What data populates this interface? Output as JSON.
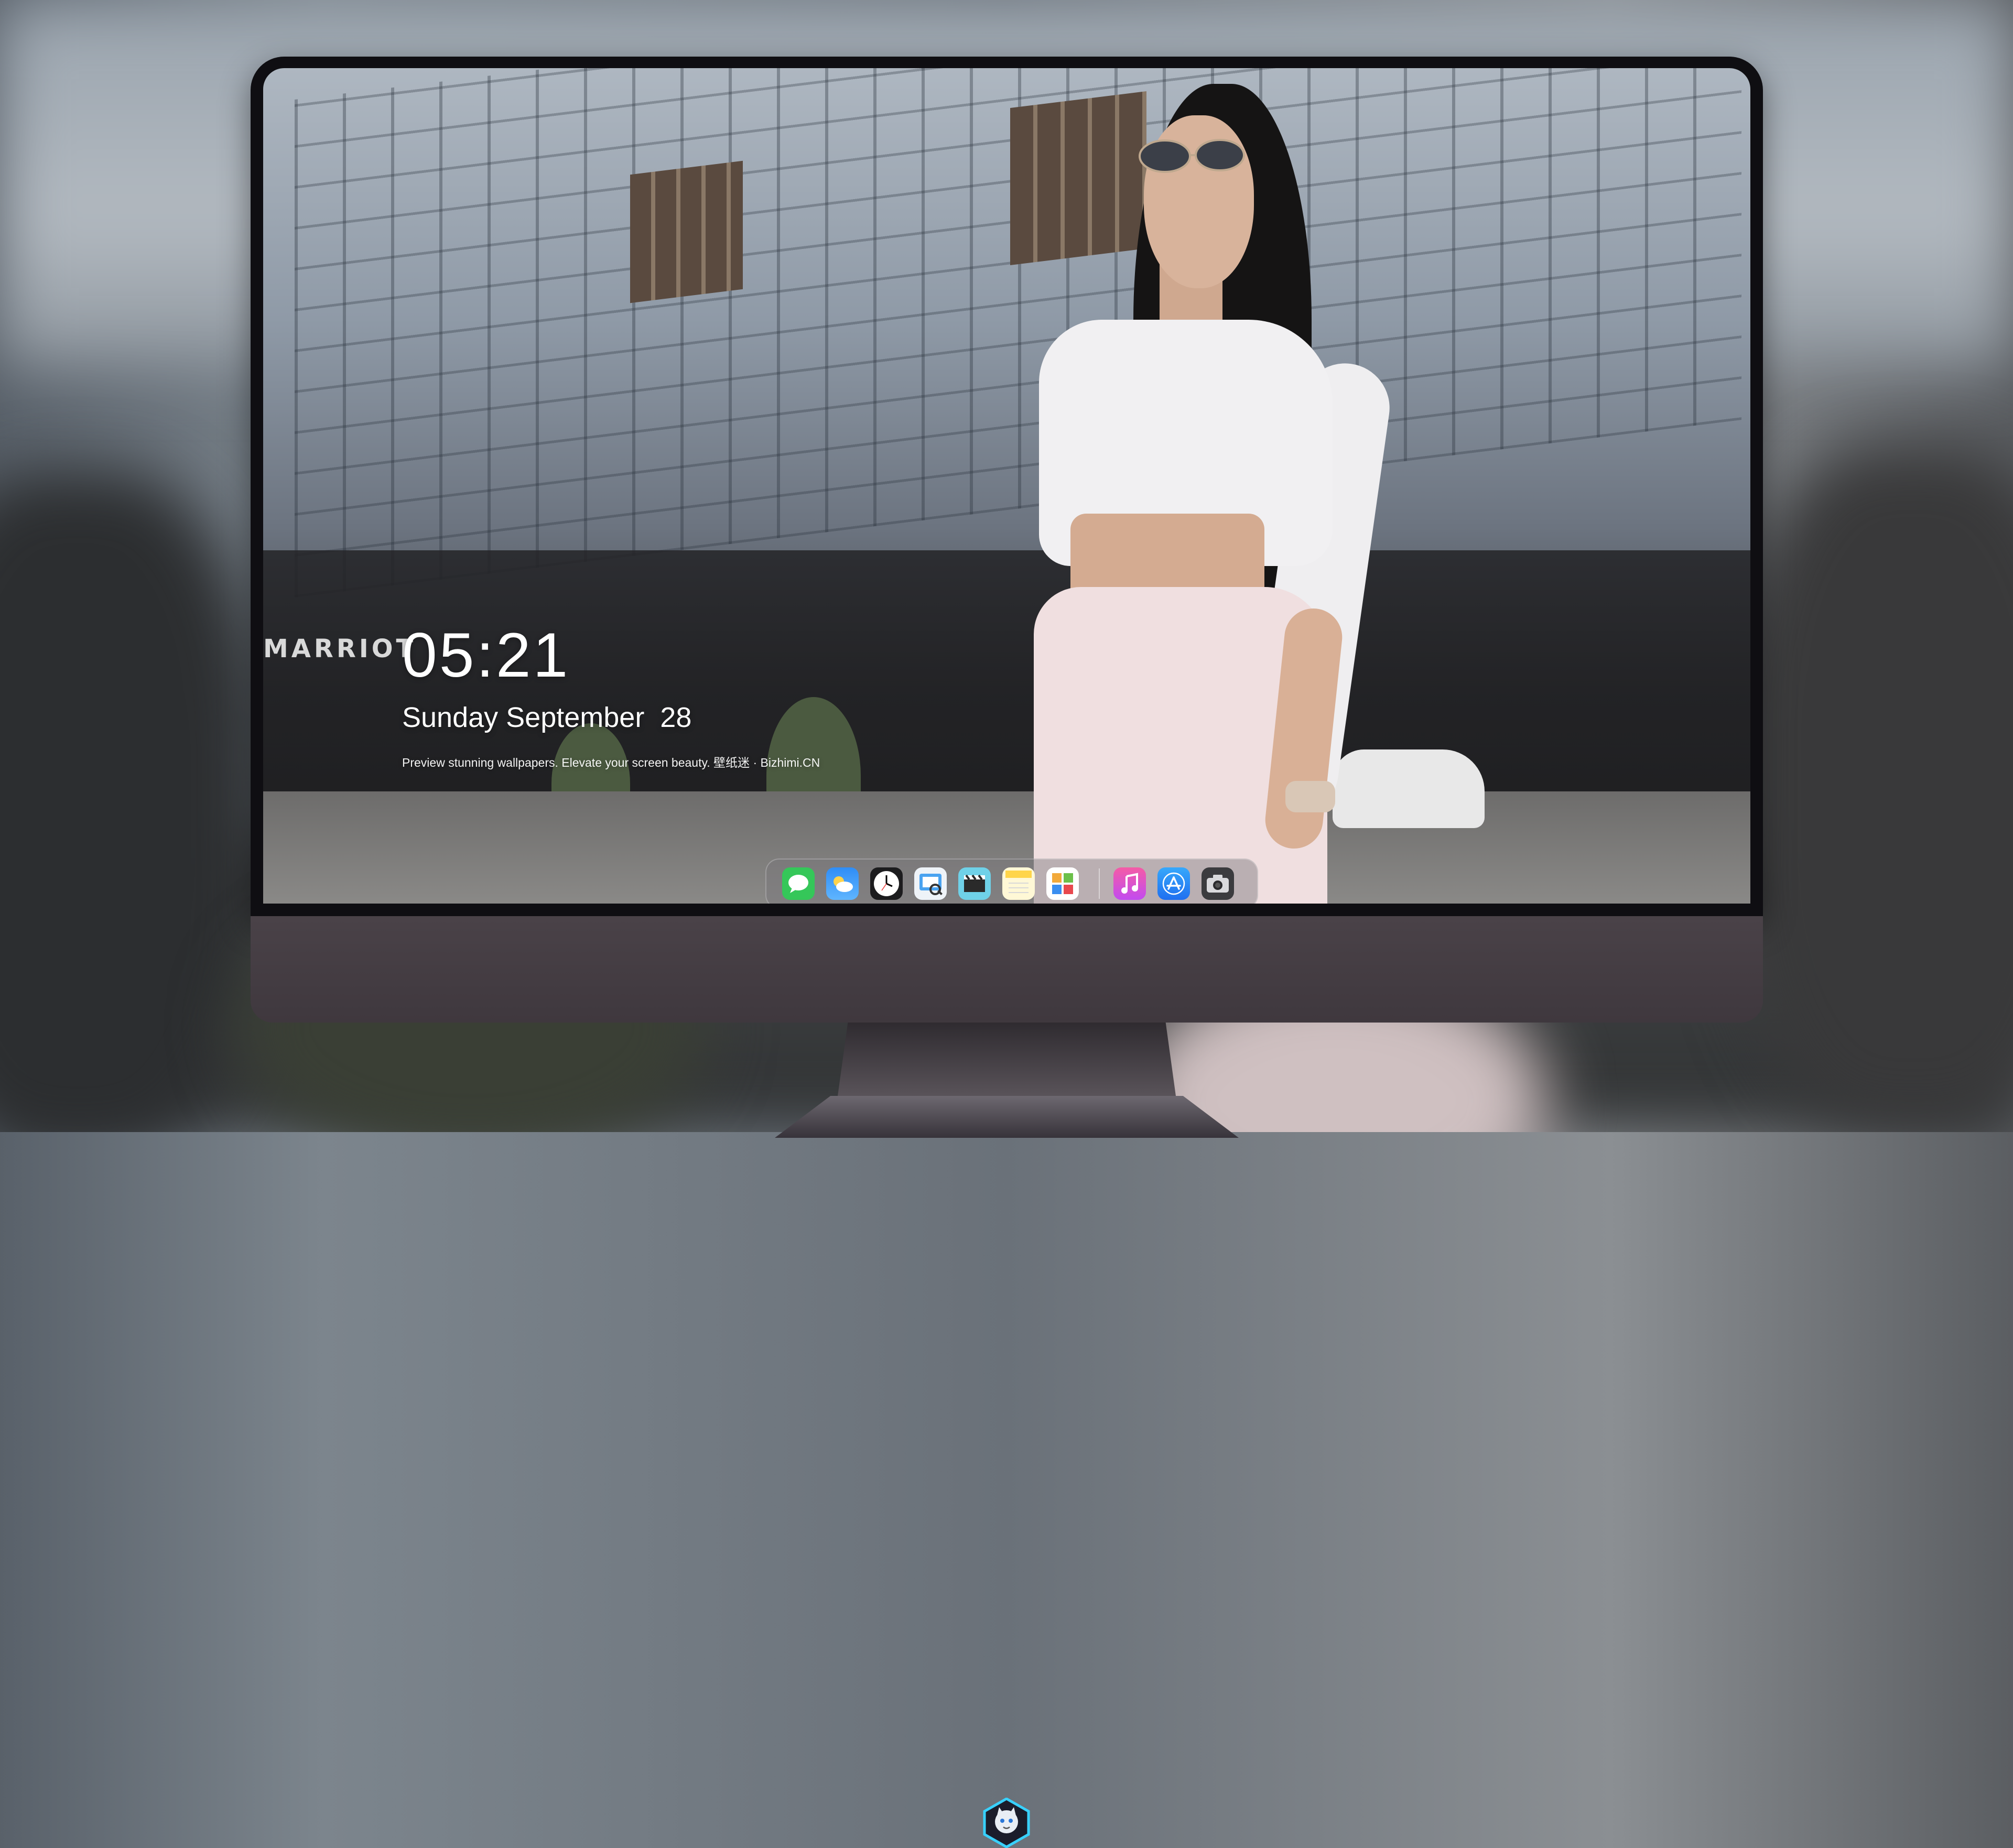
{
  "lock_screen": {
    "time": "05:21",
    "date": "Sunday September  28",
    "tagline": "Preview stunning wallpapers. Elevate your screen beauty. 壁纸迷 · Bizhimi.CN"
  },
  "wallpaper": {
    "building_sign": "MARRIOT"
  },
  "dock": {
    "apps": [
      {
        "name": "messages-icon",
        "color": "#35c759"
      },
      {
        "name": "weather-icon",
        "color": "#2f8df6"
      },
      {
        "name": "clock-icon",
        "color": "#ffffff"
      },
      {
        "name": "preview-icon",
        "color": "#f2c94c"
      },
      {
        "name": "clips-icon",
        "color": "#6fd1e8"
      },
      {
        "name": "notes-icon",
        "color": "#ffd54a"
      },
      {
        "name": "photos-icon",
        "color": "#ffffff"
      },
      {
        "name": "music-icon",
        "color": "#f45ca6"
      },
      {
        "name": "app-store-icon",
        "color": "#2a8ef5"
      },
      {
        "name": "camera-icon",
        "color": "#2e2e30"
      }
    ]
  },
  "colors": {
    "bezel": "#0f0e12",
    "chin": "#4a4248",
    "accent_cyan": "#38d1ff"
  }
}
